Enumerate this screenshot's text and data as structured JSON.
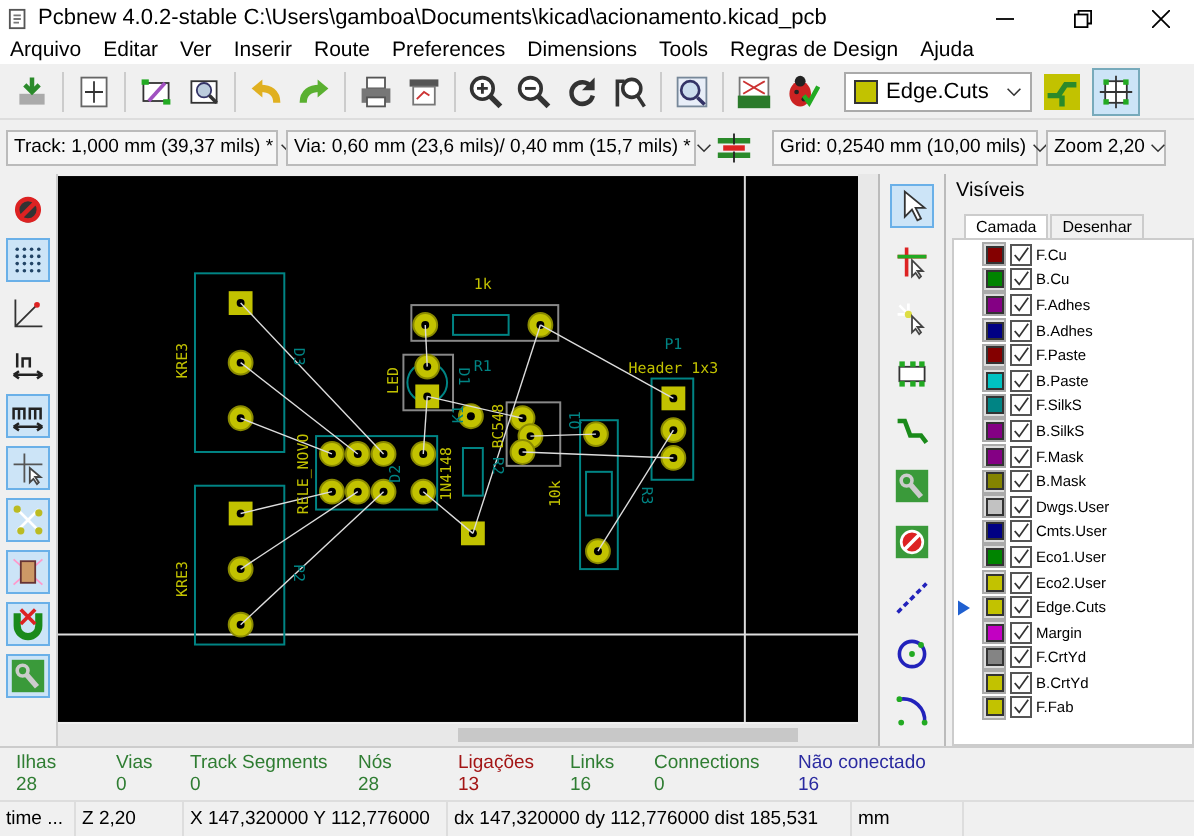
{
  "window": {
    "title": "Pcbnew 4.0.2-stable C:\\Users\\gamboa\\Documents\\kicad\\acionamento.kicad_pcb"
  },
  "menu": [
    "Arquivo",
    "Editar",
    "Ver",
    "Inserir",
    "Route",
    "Preferences",
    "Dimensions",
    "Tools",
    "Regras de Design",
    "Ajuda"
  ],
  "toolbar": {
    "active_layer": {
      "name": "Edge.Cuts",
      "color": "#c2c200"
    },
    "layers_panel_toggle_selected": true
  },
  "options_bar": {
    "track": "Track: 1,000 mm (39,37 mils) *",
    "via": "Via: 0,60 mm (23,6 mils)/ 0,40 mm (15,7 mils) *",
    "grid": "Grid: 0,2540 mm (10,00 mils)",
    "zoom": "Zoom 2,20"
  },
  "left_toolbar": [
    {
      "selected": false
    },
    {
      "selected": true
    },
    {
      "selected": false
    },
    {
      "selected": false
    },
    {
      "selected": true
    },
    {
      "selected": true
    },
    {
      "selected": true
    },
    {
      "selected": true
    },
    {
      "selected": true
    },
    {
      "selected": true
    }
  ],
  "right_toolbar": [
    {
      "selected": true
    },
    {
      "selected": false
    },
    {
      "selected": false
    },
    {
      "selected": false
    },
    {
      "selected": false
    },
    {
      "selected": false
    },
    {
      "selected": false
    },
    {
      "selected": false
    },
    {
      "selected": false
    },
    {
      "selected": false
    }
  ],
  "board_labels": [
    "1k",
    "KRE3",
    "D3",
    "KRE3",
    "P2",
    "RELE_NOVO",
    "D2",
    "1N4148",
    "K1",
    "LED",
    "D1",
    "R1",
    "BC548",
    "R2",
    "10k",
    "Q1",
    "R3",
    "P1",
    "Header 1x3"
  ],
  "layers_panel": {
    "title": "Visíveis",
    "tabs": [
      {
        "label": "Camada",
        "selected": true
      },
      {
        "label": "Desenhar",
        "selected": false
      }
    ],
    "layers": [
      {
        "name": "F.Cu",
        "color": "#840000",
        "checked": true,
        "selected": false
      },
      {
        "name": "B.Cu",
        "color": "#008400",
        "checked": true,
        "selected": false
      },
      {
        "name": "F.Adhes",
        "color": "#840084",
        "checked": true,
        "selected": false
      },
      {
        "name": "B.Adhes",
        "color": "#000084",
        "checked": true,
        "selected": false
      },
      {
        "name": "F.Paste",
        "color": "#840000",
        "checked": true,
        "selected": false
      },
      {
        "name": "B.Paste",
        "color": "#00c2c2",
        "checked": true,
        "selected": false
      },
      {
        "name": "F.SilkS",
        "color": "#008484",
        "checked": true,
        "selected": false
      },
      {
        "name": "B.SilkS",
        "color": "#840084",
        "checked": true,
        "selected": false
      },
      {
        "name": "F.Mask",
        "color": "#840084",
        "checked": true,
        "selected": false
      },
      {
        "name": "B.Mask",
        "color": "#848400",
        "checked": true,
        "selected": false
      },
      {
        "name": "Dwgs.User",
        "color": "#c2c2c2",
        "checked": true,
        "selected": false
      },
      {
        "name": "Cmts.User",
        "color": "#000084",
        "checked": true,
        "selected": false
      },
      {
        "name": "Eco1.User",
        "color": "#008400",
        "checked": true,
        "selected": false
      },
      {
        "name": "Eco2.User",
        "color": "#c2c200",
        "checked": true,
        "selected": false
      },
      {
        "name": "Edge.Cuts",
        "color": "#c2c200",
        "checked": true,
        "selected": true
      },
      {
        "name": "Margin",
        "color": "#c200c2",
        "checked": true,
        "selected": false
      },
      {
        "name": "F.CrtYd",
        "color": "#848484",
        "checked": true,
        "selected": false
      },
      {
        "name": "B.CrtYd",
        "color": "#c2c200",
        "checked": true,
        "selected": false
      },
      {
        "name": "F.Fab",
        "color": "#c2c200",
        "checked": true,
        "selected": false
      }
    ]
  },
  "message_panel": [
    {
      "label": "Ilhas",
      "value": "28",
      "color": "#2f7d32"
    },
    {
      "label": "Vias",
      "value": "0",
      "color": "#2f7d32"
    },
    {
      "label": "Track Segments",
      "value": "0",
      "color": "#2f7d32"
    },
    {
      "label": "Nós",
      "value": "28",
      "color": "#2f7d32"
    },
    {
      "label": "Ligações",
      "value": "13",
      "color": "#a31515"
    },
    {
      "label": "Links",
      "value": "16",
      "color": "#2f7d32"
    },
    {
      "label": "Connections",
      "value": "0",
      "color": "#2f7d32"
    },
    {
      "label": "Não conectado",
      "value": "16",
      "color": "#2a2aa0"
    }
  ],
  "status_bar": [
    "time ...",
    "Z 2,20",
    "X 147,320000  Y 112,776000",
    "dx 147,320000  dy 112,776000  dist 185,531",
    "mm"
  ]
}
